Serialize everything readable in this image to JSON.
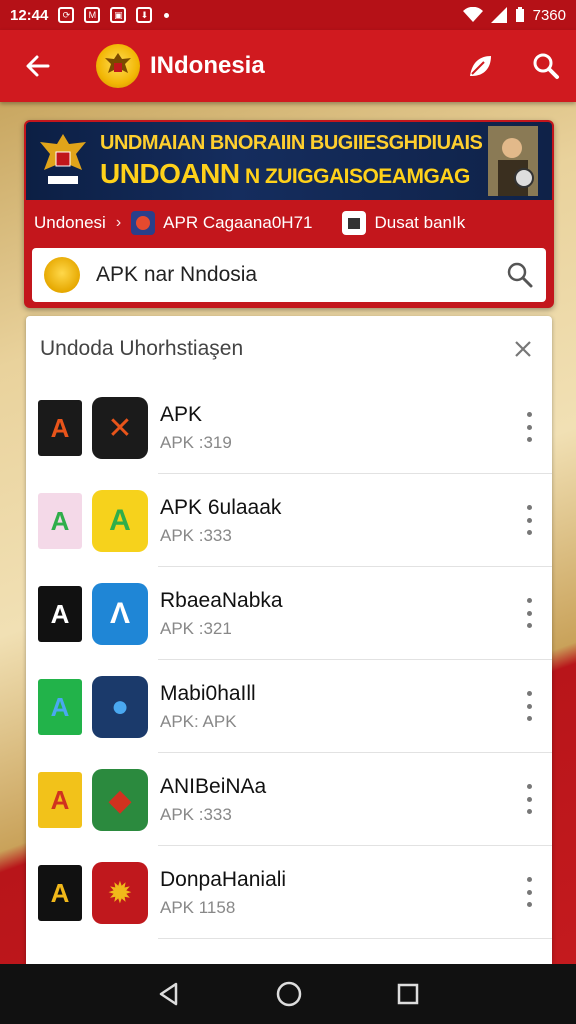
{
  "status_bar": {
    "time": "12:44",
    "battery": "7360"
  },
  "app_bar": {
    "title": "INdonesia",
    "back": "back-arrow-icon",
    "actions": [
      "leaf-icon",
      "search-icon"
    ]
  },
  "banner": {
    "line1": "UNDMAIAN BNORAIIN BUGIIESGHDIUAIS",
    "line2a": "UNDOANN",
    "line2b": " N ZUIGGAISOEAMGAG"
  },
  "breadcrumbs": [
    {
      "label": "Undonesi"
    },
    {
      "label": "APR Cagaana0H71"
    },
    {
      "label": "Dusat banIk"
    }
  ],
  "search": {
    "value": "APK nar Nndosia"
  },
  "panel": {
    "title": "Undoda Uhorhstiaşen"
  },
  "apps": [
    {
      "name": "APK",
      "sub": "APK :319",
      "ic1_color": "#1a1a1a",
      "ic2_color": "#1b1b1b",
      "accent": "#e8541a"
    },
    {
      "name": "APK 6ulaaak",
      "sub": "APK :333",
      "ic1_color": "#f4d9e8",
      "ic2_color": "#f6d21c",
      "accent": "#2fae4a"
    },
    {
      "name": "RbaeaNabka",
      "sub": "APK :321",
      "ic1_color": "#111111",
      "ic2_color": "#1f86d6",
      "accent": "#ffffff"
    },
    {
      "name": "Mabi0haIll",
      "sub": "APK: APK",
      "ic1_color": "#22b34a",
      "ic2_color": "#1b3a6b",
      "accent": "#4aa8f0"
    },
    {
      "name": "ANIBeiNAa",
      "sub": "APK :333",
      "ic1_color": "#f2c21a",
      "ic2_color": "#2b8a3e",
      "accent": "#d0321f"
    },
    {
      "name": "DonpaHaniali",
      "sub": "APK 1158",
      "ic1_color": "#111111",
      "ic2_color": "#c0181d",
      "accent": "#f1b81a"
    }
  ],
  "colors": {
    "brand_red": "#d01a1f",
    "status_red": "#b51117"
  }
}
